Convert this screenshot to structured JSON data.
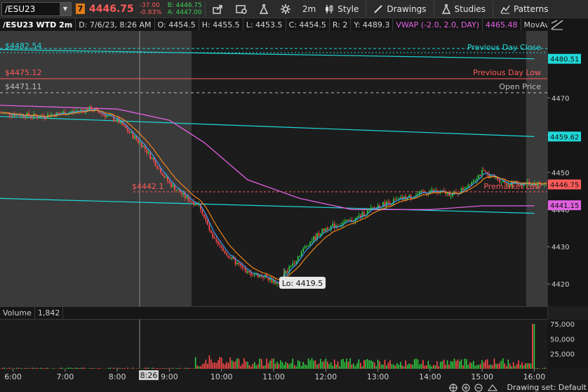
{
  "toolbar": {
    "symbol": "/ESU23",
    "badge": "7",
    "last_price": "4446.75",
    "net_change": "-37.00",
    "pct_change": "-0.83%",
    "bid": "B: 4446.75",
    "ask": "A: 4447.00",
    "timeframe": "2m",
    "style_label": "Style",
    "drawings_label": "Drawings",
    "studies_label": "Studies",
    "patterns_label": "Patterns"
  },
  "infobar": {
    "symbol": "/ESU23 WTD 2m",
    "datetime": "D: 7/6/23, 8:26 AM",
    "open": "O: 4454.5",
    "high": "H: 4455.5",
    "low": "L: 4453.5",
    "close": "C: 4454.5",
    "range": "R: 2",
    "y": "Y: 4489.3",
    "vwap_label": "VWAP (-2.0, 2.0, DAY)",
    "vwap_value": "4465.48",
    "mavg_label": "MovAvg..."
  },
  "levels": {
    "prev_close_price": "$4482.54",
    "prev_close_label": "Previous Day Close",
    "prev_low_price": "$4475.12",
    "prev_low_label": "Previous Day Low",
    "open_price": "$4471.11",
    "open_label": "Open Price",
    "premarket_low_price": "$4442.1",
    "premarket_low_label": "Premarket Low",
    "lo_label": "Lo: 4419.5"
  },
  "axis": {
    "price_ticks": [
      "4470",
      "4460",
      "4450",
      "4440",
      "4430",
      "4420"
    ],
    "badges": [
      {
        "text": "4480.51",
        "color": "#20d8d8"
      },
      {
        "text": "4459.62",
        "color": "#20d8d8"
      },
      {
        "text": "4446.75",
        "color": "#ff5b5b"
      },
      {
        "text": "4441.15",
        "color": "#e060e0"
      }
    ],
    "volume_ticks": [
      "75,000",
      "50,000",
      "25,000"
    ],
    "time_ticks": [
      "6:00",
      "7:00",
      "8:00",
      "9:00",
      "10:00",
      "11:00",
      "12:00",
      "13:00",
      "14:00",
      "15:00",
      "16:00"
    ],
    "cursor_time": "8:26"
  },
  "volume": {
    "label": "Volume",
    "value": "1,842"
  },
  "bottom": {
    "drawing_set": "Drawing set: Default"
  },
  "colors": {
    "up": "#2ecc40",
    "down": "#ff4a4a",
    "vwap": "#e060e0",
    "band": "#20d8d8",
    "ma_orange": "#ff8c1a",
    "ma_blue": "#3aa0ff"
  },
  "chart_data": {
    "type": "candlestick",
    "y_range": [
      4414,
      4488
    ],
    "x_range": [
      "5:45",
      "16:15"
    ],
    "price_path": [
      [
        "5:45",
        4466
      ],
      [
        "6:30",
        4465
      ],
      [
        "7:00",
        4466
      ],
      [
        "7:30",
        4467
      ],
      [
        "8:00",
        4464
      ],
      [
        "8:30",
        4457
      ],
      [
        "9:00",
        4447
      ],
      [
        "9:20",
        4443
      ],
      [
        "9:35",
        4441
      ],
      [
        "9:50",
        4432
      ],
      [
        "10:10",
        4427
      ],
      [
        "10:30",
        4423
      ],
      [
        "10:50",
        4422
      ],
      [
        "11:05",
        4420
      ],
      [
        "11:20",
        4425
      ],
      [
        "11:40",
        4431
      ],
      [
        "12:00",
        4435
      ],
      [
        "12:30",
        4437
      ],
      [
        "13:00",
        4441
      ],
      [
        "13:30",
        4443
      ],
      [
        "14:00",
        4445
      ],
      [
        "14:30",
        4444
      ],
      [
        "15:00",
        4450
      ],
      [
        "15:30",
        4447
      ],
      [
        "16:00",
        4447
      ]
    ],
    "vwap_path": [
      [
        "5:45",
        4468
      ],
      [
        "8:00",
        4467
      ],
      [
        "9:00",
        4464
      ],
      [
        "9:40",
        4458
      ],
      [
        "10:30",
        4448
      ],
      [
        "11:30",
        4443
      ],
      [
        "12:30",
        4440
      ],
      [
        "14:00",
        4440
      ],
      [
        "15:00",
        4441
      ],
      [
        "16:00",
        4441
      ]
    ],
    "band_upper_path": [
      [
        "5:45",
        4483
      ],
      [
        "16:00",
        4480.5
      ]
    ],
    "band_mid_path": [
      [
        "5:45",
        4465
      ],
      [
        "16:00",
        4459.6
      ]
    ],
    "band_lower_path": [
      [
        "5:45",
        4443
      ],
      [
        "16:00",
        4439
      ]
    ],
    "volume_max": 75000
  }
}
